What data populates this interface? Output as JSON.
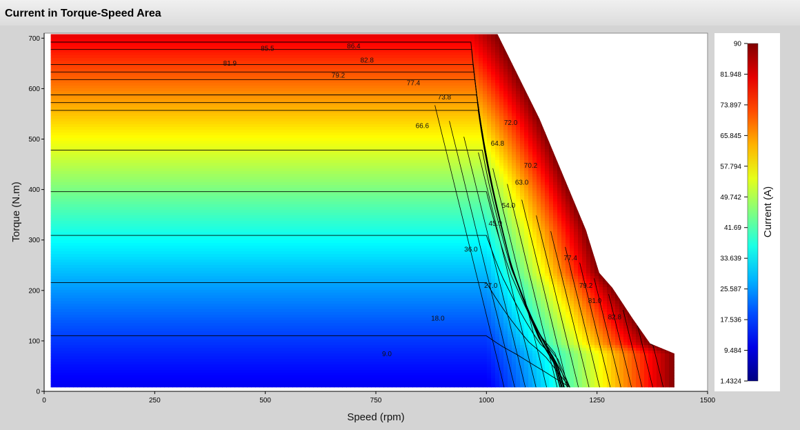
{
  "window": {
    "title": "Current in Torque-Speed Area"
  },
  "chart_data": {
    "type": "heatmap",
    "title": "",
    "xlabel": "Speed (rpm)",
    "ylabel": "Torque (N.m)",
    "xlim": [
      0,
      1500
    ],
    "ylim": [
      0,
      710
    ],
    "x_ticks": [
      0,
      250,
      500,
      750,
      1000,
      1250,
      1500
    ],
    "y_ticks": [
      0,
      100,
      200,
      300,
      400,
      500,
      600,
      700
    ],
    "colorbar": {
      "label": "Current (A)",
      "min": 1.4324,
      "max": 90,
      "tick_labels": [
        "90",
        "81.948",
        "73.897",
        "65.845",
        "57.794",
        "49.742",
        "41.69",
        "33.639",
        "25.587",
        "17.536",
        "9.484",
        "1.4324"
      ],
      "colormap": "jet"
    },
    "contour_levels": [
      9.0,
      18.0,
      27.0,
      36.0,
      45.0,
      54.0,
      63.0,
      64.8,
      66.6,
      70.2,
      72.0,
      73.8,
      77.4,
      79.2,
      81.9,
      82.8,
      85.5,
      86.4
    ],
    "contour_labels": [
      {
        "text": "9.0",
        "x": 775,
        "y": 70
      },
      {
        "text": "18.0",
        "x": 890,
        "y": 140
      },
      {
        "text": "27.0",
        "x": 1010,
        "y": 205
      },
      {
        "text": "36.0",
        "x": 965,
        "y": 277
      },
      {
        "text": "45.0",
        "x": 1020,
        "y": 328
      },
      {
        "text": "54.0",
        "x": 1050,
        "y": 364
      },
      {
        "text": "63.0",
        "x": 1080,
        "y": 410
      },
      {
        "text": "70.2",
        "x": 1100,
        "y": 443
      },
      {
        "text": "64.8",
        "x": 1025,
        "y": 487
      },
      {
        "text": "72.0",
        "x": 1055,
        "y": 528
      },
      {
        "text": "66.6",
        "x": 855,
        "y": 522
      },
      {
        "text": "73.8",
        "x": 905,
        "y": 579
      },
      {
        "text": "77.4",
        "x": 835,
        "y": 607
      },
      {
        "text": "79.2",
        "x": 665,
        "y": 622
      },
      {
        "text": "81.9",
        "x": 420,
        "y": 646
      },
      {
        "text": "82.8",
        "x": 730,
        "y": 652
      },
      {
        "text": "85.5",
        "x": 505,
        "y": 675
      },
      {
        "text": "86.4",
        "x": 700,
        "y": 680
      },
      {
        "text": "77.4",
        "x": 1190,
        "y": 260
      },
      {
        "text": "79.2",
        "x": 1225,
        "y": 205
      },
      {
        "text": "81.0",
        "x": 1245,
        "y": 175
      },
      {
        "text": "82.8",
        "x": 1290,
        "y": 143
      }
    ],
    "data_region": {
      "boundary": [
        [
          15,
          8
        ],
        [
          15,
          708
        ],
        [
          1025,
          708
        ],
        [
          1120,
          540
        ],
        [
          1225,
          320
        ],
        [
          1255,
          235
        ],
        [
          1285,
          205
        ],
        [
          1330,
          145
        ],
        [
          1370,
          95
        ],
        [
          1425,
          75
        ],
        [
          1425,
          8
        ]
      ],
      "corner_speed": 1000,
      "corner_torque": 490,
      "current_min": 1.4324,
      "current_max": 90
    }
  }
}
